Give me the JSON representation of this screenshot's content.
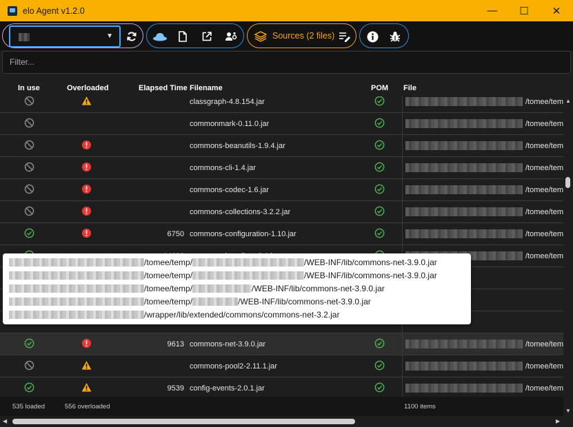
{
  "window": {
    "title": "elo Agent v1.2.0",
    "minimize": "—",
    "maximize": "☐",
    "close": "✕"
  },
  "toolbar": {
    "combo_icon": "chevron-down-icon",
    "sources_label": "Sources (2 files)",
    "icons": [
      "refresh-icon",
      "hat-icon",
      "document-icon",
      "open-external-icon",
      "user-settings-icon",
      "stack-icon",
      "edit-list-icon",
      "info-icon",
      "bug-icon"
    ]
  },
  "filter": {
    "placeholder": "Filter...",
    "value": ""
  },
  "table": {
    "columns": [
      "In use",
      "Overloaded",
      "Elapsed Time",
      "Filename",
      "POM",
      "File"
    ],
    "rows": [
      {
        "in_use": "not-used",
        "overloaded": "warning",
        "elapsed": "",
        "filename": "classgraph-4.8.154.jar",
        "pom": true,
        "file_suffix": "/tomee/tem"
      },
      {
        "in_use": "not-used",
        "overloaded": "",
        "elapsed": "",
        "filename": "commonmark-0.11.0.jar",
        "pom": true,
        "file_suffix": "/tomee/tem"
      },
      {
        "in_use": "not-used",
        "overloaded": "error",
        "elapsed": "",
        "filename": "commons-beanutils-1.9.4.jar",
        "pom": true,
        "file_suffix": "/tomee/tem"
      },
      {
        "in_use": "not-used",
        "overloaded": "error",
        "elapsed": "",
        "filename": "commons-cli-1.4.jar",
        "pom": true,
        "file_suffix": "/tomee/tem"
      },
      {
        "in_use": "not-used",
        "overloaded": "error",
        "elapsed": "",
        "filename": "commons-codec-1.6.jar",
        "pom": true,
        "file_suffix": "/tomee/tem"
      },
      {
        "in_use": "not-used",
        "overloaded": "error",
        "elapsed": "",
        "filename": "commons-collections-3.2.2.jar",
        "pom": true,
        "file_suffix": "/tomee/tem"
      },
      {
        "in_use": "used",
        "overloaded": "error",
        "elapsed": "6750",
        "filename": "commons-configuration-1.10.jar",
        "pom": true,
        "file_suffix": "/tomee/tem"
      },
      {
        "in_use": "used",
        "overloaded": "",
        "elapsed": "14636",
        "filename": "commons-httpclient-3.1.jar",
        "pom": true,
        "file_suffix": "/tomee/tem"
      },
      {
        "in_use": "",
        "overloaded": "",
        "elapsed": "",
        "filename": "",
        "pom": false,
        "file_suffix": ""
      },
      {
        "in_use": "",
        "overloaded": "",
        "elapsed": "",
        "filename": "",
        "pom": false,
        "file_suffix": ""
      },
      {
        "in_use": "",
        "overloaded": "",
        "elapsed": "",
        "filename": "",
        "pom": false,
        "file_suffix": ""
      },
      {
        "in_use": "used",
        "overloaded": "error",
        "elapsed": "9613",
        "filename": "commons-net-3.9.0.jar",
        "pom": true,
        "file_suffix": "/tomee/tem"
      },
      {
        "in_use": "not-used",
        "overloaded": "warning",
        "elapsed": "",
        "filename": "commons-pool2-2.11.1.jar",
        "pom": true,
        "file_suffix": "/tomee/tem"
      },
      {
        "in_use": "used",
        "overloaded": "warning",
        "elapsed": "9539",
        "filename": "config-events-2.0.1.jar",
        "pom": true,
        "file_suffix": "/tomee/tem"
      }
    ]
  },
  "tooltip": {
    "lines": [
      "/tomee/temp/",
      "/WEB-INF/lib/commons-net-3.9.0.jar",
      "/tomee/temp/",
      "/WEB-INF/lib/commons-net-3.9.0.jar",
      "/tomee/temp/",
      "/WEB-INF/lib/commons-net-3.9.0.jar",
      "/tomee/temp/",
      "/WEB-INF/lib/commons-net-3.9.0.jar",
      "/wrapper/lib/extended/commons/commons-net-3.2.jar"
    ]
  },
  "status": {
    "loaded": "535 loaded",
    "overloaded": "556 overloaded",
    "items": "1100 items"
  },
  "colors": {
    "accent": "#f9b000",
    "ok": "#4caf50",
    "error": "#e53935",
    "warning": "#f5a623",
    "sources": "#f3a21d"
  }
}
